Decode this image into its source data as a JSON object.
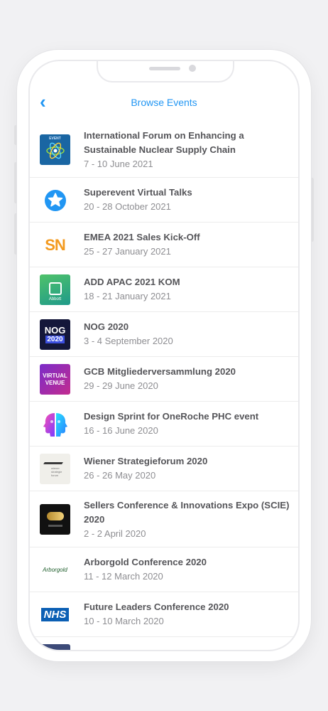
{
  "nav": {
    "back_icon": "chevron-left-icon",
    "title": "Browse Events"
  },
  "events": [
    {
      "title": "International Forum on Enhancing a Sustainable Nuclear Supply Chain",
      "date": "7 - 10 June 2021",
      "thumb": {
        "icon": "nuclear-atom-logo",
        "bg": "#1a66a3",
        "label": "EVENT"
      }
    },
    {
      "title": "Superevent Virtual Talks",
      "date": "20 - 28 October 2021",
      "thumb": {
        "icon": "star-badge-icon",
        "bg": "#ffffff",
        "accent": "#2196f3"
      }
    },
    {
      "title": "EMEA 2021 Sales Kick-Off",
      "date": "25 - 27 January 2021",
      "thumb": {
        "icon": "sn-logo",
        "bg": "#ffffff",
        "label": "SN",
        "accent": "#f39a1f"
      }
    },
    {
      "title": "ADD APAC 2021 KOM",
      "date": "18 - 21 January 2021",
      "thumb": {
        "icon": "abbott-logo",
        "label": "Abbott",
        "accent": "#27a36b"
      }
    },
    {
      "title": "NOG 2020",
      "date": "3 - 4 September 2020",
      "thumb": {
        "icon": "nog-logo",
        "bg": "#14173a",
        "label": "NOG",
        "label2": "2020"
      }
    },
    {
      "title": "GCB Mitgliederversammlung 2020",
      "date": "29 - 29 June 2020",
      "thumb": {
        "icon": "virtual-venue-logo",
        "label": "VIRTUAL",
        "label2": "VENUE"
      }
    },
    {
      "title": "Design Sprint for OneRoche PHC event",
      "date": "16 - 16 June 2020",
      "thumb": {
        "icon": "heads-profile-logo",
        "bg": "#ffffff"
      }
    },
    {
      "title": "Wiener Strategieforum 2020",
      "date": "26 - 26 May 2020",
      "thumb": {
        "icon": "strategieforum-logo",
        "bg": "#f0efea",
        "label": "wiener strategie forum"
      }
    },
    {
      "title": "Sellers Conference & Innovations Expo (SCIE) 2020",
      "date": "2 - 2 April 2020",
      "thumb": {
        "icon": "scie-logo",
        "bg": "#111111"
      }
    },
    {
      "title": "Arborgold Conference 2020",
      "date": "11 - 12 March 2020",
      "thumb": {
        "icon": "arborgold-logo",
        "bg": "#ffffff",
        "label": "Arborgold"
      }
    },
    {
      "title": "Future Leaders Conference 2020",
      "date": "10 - 10 March 2020",
      "thumb": {
        "icon": "nhs-logo",
        "bg": "#ffffff",
        "label": "NHS",
        "accent": "#0b5fb4"
      }
    }
  ]
}
